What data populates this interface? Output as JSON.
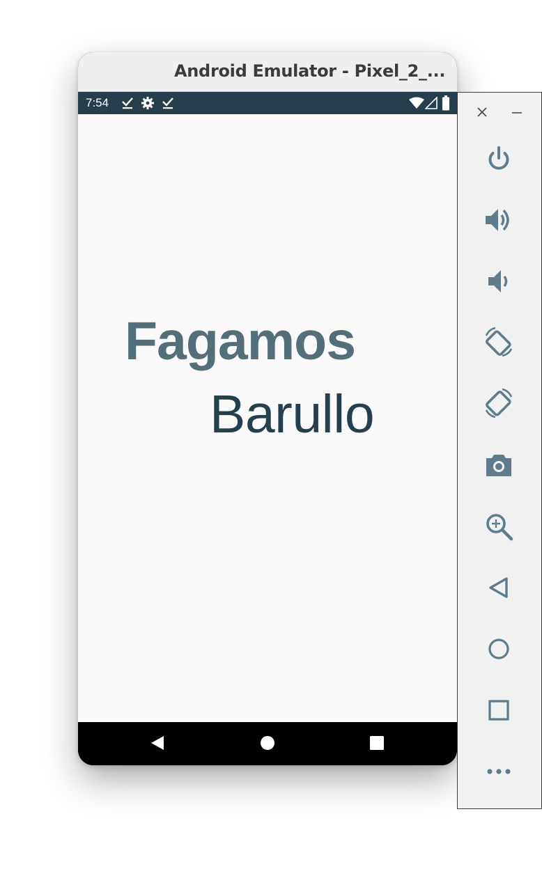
{
  "window": {
    "title": "Android Emulator - Pixel_2_..."
  },
  "status_bar": {
    "time": "7:54",
    "left_icons": [
      "download-done-icon",
      "settings-gear-icon",
      "download-done-icon"
    ],
    "right_icons": [
      "wifi-icon",
      "signal-icon",
      "battery-icon"
    ]
  },
  "app": {
    "line1": "Fagamos",
    "line2": "Barullo"
  },
  "nav_bar": {
    "buttons": [
      "back-icon",
      "home-icon",
      "recents-icon"
    ]
  },
  "toolbar": {
    "window_controls": [
      "close-icon",
      "minimize-icon"
    ],
    "buttons": [
      "power-icon",
      "volume-up-icon",
      "volume-down-icon",
      "rotate-left-icon",
      "rotate-right-icon",
      "camera-icon",
      "zoom-icon",
      "back-icon",
      "home-icon",
      "overview-icon",
      "more-icon"
    ]
  },
  "colors": {
    "status_bar": "#263f4c",
    "line1_text": "#546e7a",
    "line2_text": "#263f4c",
    "toolbar_icon": "#5e7c8b"
  }
}
